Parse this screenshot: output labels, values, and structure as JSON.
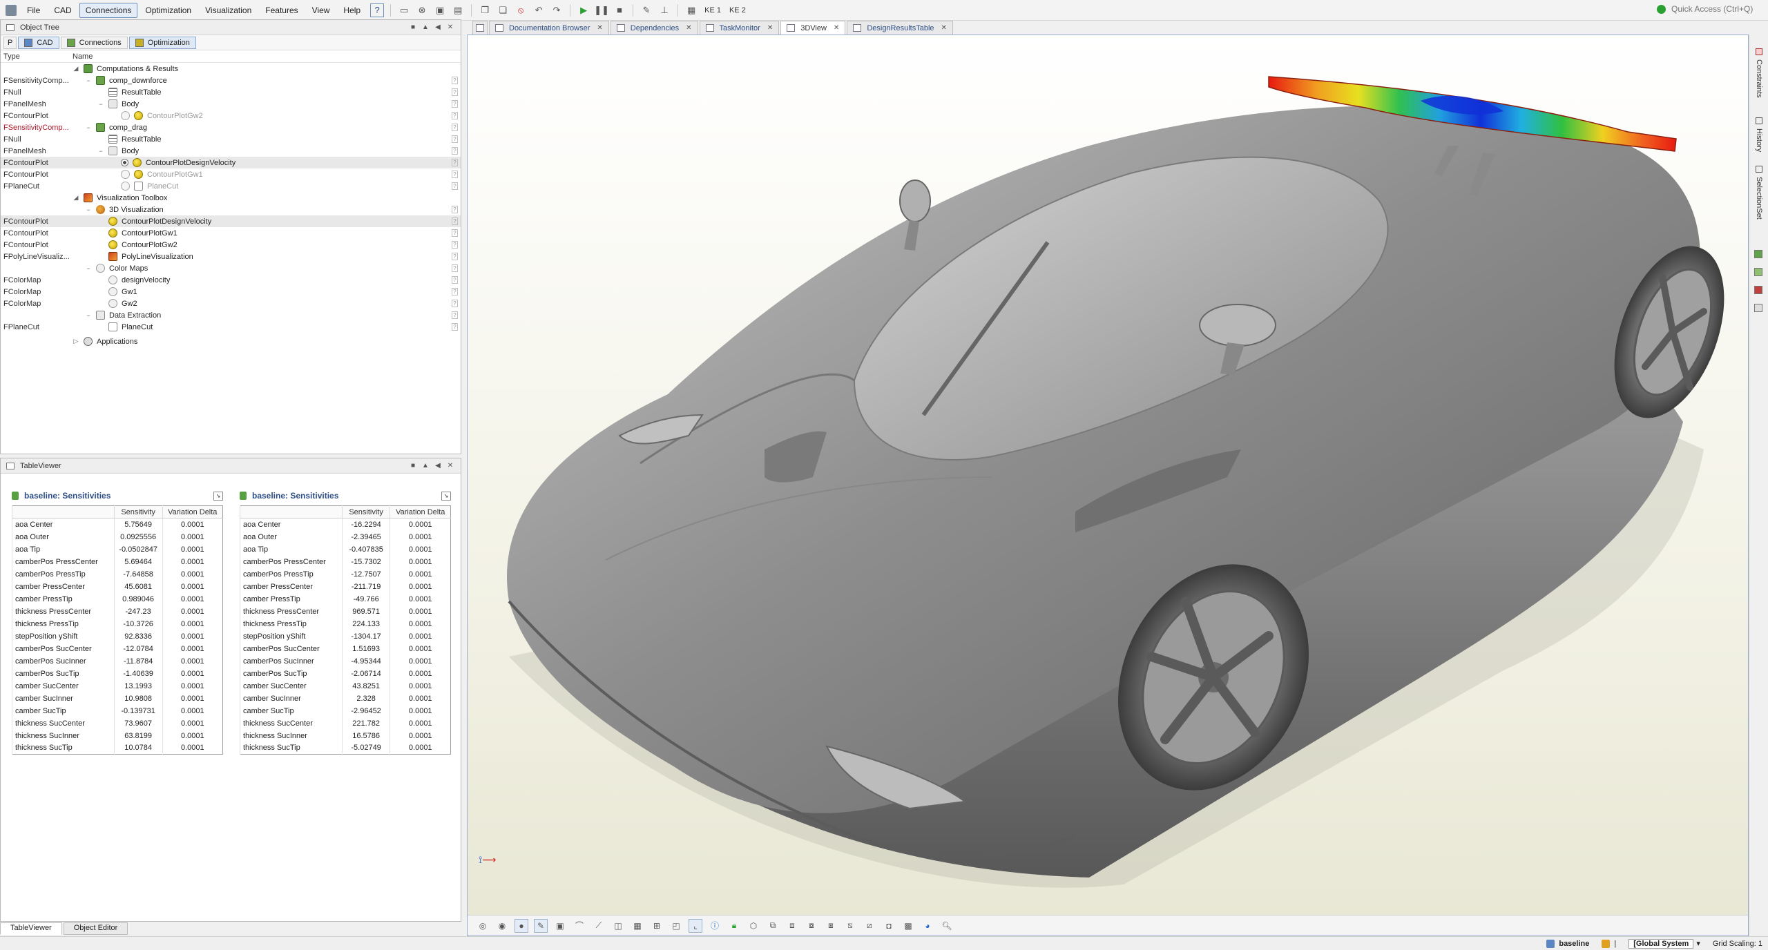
{
  "menu": {
    "items": [
      "File",
      "CAD",
      "Connections",
      "Optimization",
      "Visualization",
      "Features",
      "View",
      "Help"
    ],
    "active": "Connections",
    "toolbar_text": [
      "KE 1",
      "KE 2"
    ],
    "quick_access_placeholder": "Quick Access (Ctrl+Q)"
  },
  "object_tree": {
    "title": "Object Tree",
    "tabs": [
      {
        "prefix": "P",
        "label": "CAD"
      },
      {
        "label": "Connections"
      },
      {
        "label": "Optimization"
      }
    ],
    "columns": {
      "type": "Type",
      "name": "Name"
    },
    "rows": [
      {
        "type": "",
        "name": "Computations & Results",
        "indent": 0,
        "exp": "◢",
        "icon": "comp"
      },
      {
        "type": "FSensitivityComp...",
        "name": "comp_downforce",
        "indent": 1,
        "exp": "−",
        "icon": "green"
      },
      {
        "type": "FNull",
        "name": "ResultTable",
        "indent": 2,
        "exp": "",
        "icon": "table"
      },
      {
        "type": "FPanelMesh",
        "name": "Body",
        "indent": 2,
        "exp": "−",
        "icon": "folder"
      },
      {
        "type": "FContourPlot",
        "name": "ContourPlotGw2",
        "indent": 3,
        "exp": "",
        "icon": "contour",
        "disabled": true,
        "ring": true
      },
      {
        "type": "FSensitivityComp...",
        "name": "comp_drag",
        "indent": 1,
        "exp": "−",
        "icon": "green",
        "red": true
      },
      {
        "type": "FNull",
        "name": "ResultTable",
        "indent": 2,
        "exp": "",
        "icon": "table"
      },
      {
        "type": "FPanelMesh",
        "name": "Body",
        "indent": 2,
        "exp": "−",
        "icon": "folder"
      },
      {
        "type": "FContourPlot",
        "name": "ContourPlotDesignVelocity",
        "indent": 3,
        "exp": "",
        "icon": "contour",
        "radio": true,
        "highlight": true
      },
      {
        "type": "FContourPlot",
        "name": "ContourPlotGw1",
        "indent": 3,
        "exp": "",
        "icon": "contour",
        "disabled": true,
        "ring": true
      },
      {
        "type": "FPlaneCut",
        "name": "PlaneCut",
        "indent": 3,
        "exp": "",
        "icon": "plane",
        "disabled": true,
        "ring": true
      },
      {
        "type": "",
        "name": "Visualization Toolbox",
        "indent": 0,
        "exp": "◢",
        "icon": "viz"
      },
      {
        "type": "",
        "name": "3D Visualization",
        "indent": 1,
        "exp": "−",
        "icon": "vis3d"
      },
      {
        "type": "FContourPlot",
        "name": "ContourPlotDesignVelocity",
        "indent": 2,
        "exp": "",
        "icon": "contour",
        "highlight": true
      },
      {
        "type": "FContourPlot",
        "name": "ContourPlotGw1",
        "indent": 2,
        "exp": "",
        "icon": "contour"
      },
      {
        "type": "FContourPlot",
        "name": "ContourPlotGw2",
        "indent": 2,
        "exp": "",
        "icon": "contour"
      },
      {
        "type": "FPolyLineVisualiz...",
        "name": "PolyLineVisualization",
        "indent": 2,
        "exp": "",
        "icon": "viz"
      },
      {
        "type": "",
        "name": "Color Maps",
        "indent": 1,
        "exp": "−",
        "icon": "cmap"
      },
      {
        "type": "FColorMap",
        "name": "designVelocity",
        "indent": 2,
        "exp": "",
        "icon": "cmap"
      },
      {
        "type": "FColorMap",
        "name": "Gw1",
        "indent": 2,
        "exp": "",
        "icon": "cmap"
      },
      {
        "type": "FColorMap",
        "name": "Gw2",
        "indent": 2,
        "exp": "",
        "icon": "cmap"
      },
      {
        "type": "",
        "name": "Data Extraction",
        "indent": 1,
        "exp": "−",
        "icon": "dataex"
      },
      {
        "type": "FPlaneCut",
        "name": "PlaneCut",
        "indent": 2,
        "exp": "",
        "icon": "plane"
      },
      {
        "type": "",
        "name": "Applications",
        "indent": 0,
        "exp": "▷",
        "icon": "apps",
        "gap": true
      }
    ]
  },
  "table_viewer": {
    "title": "TableViewer",
    "columns": [
      "",
      "Sensitivity",
      "Variation Delta"
    ],
    "tables": [
      {
        "title": "baseline: Sensitivities",
        "rows": [
          [
            "aoa  Center",
            "5.75649",
            "0.0001"
          ],
          [
            "aoa  Outer",
            "0.0925556",
            "0.0001"
          ],
          [
            "aoa  Tip",
            "-0.0502847",
            "0.0001"
          ],
          [
            "camberPos  PressCenter",
            "5.69464",
            "0.0001"
          ],
          [
            "camberPos  PressTip",
            "-7.64858",
            "0.0001"
          ],
          [
            "camber  PressCenter",
            "45.6081",
            "0.0001"
          ],
          [
            "camber  PressTip",
            "0.989046",
            "0.0001"
          ],
          [
            "thickness  PressCenter",
            "-247.23",
            "0.0001"
          ],
          [
            "thickness  PressTip",
            "-10.3726",
            "0.0001"
          ],
          [
            "stepPosition  yShift",
            "92.8336",
            "0.0001"
          ],
          [
            "camberPos  SucCenter",
            "-12.0784",
            "0.0001"
          ],
          [
            "camberPos  SucInner",
            "-11.8784",
            "0.0001"
          ],
          [
            "camberPos  SucTip",
            "-1.40639",
            "0.0001"
          ],
          [
            "camber  SucCenter",
            "13.1993",
            "0.0001"
          ],
          [
            "camber  SucInner",
            "10.9808",
            "0.0001"
          ],
          [
            "camber  SucTip",
            "-0.139731",
            "0.0001"
          ],
          [
            "thickness  SucCenter",
            "73.9607",
            "0.0001"
          ],
          [
            "thickness  SucInner",
            "63.8199",
            "0.0001"
          ],
          [
            "thickness  SucTip",
            "10.0784",
            "0.0001"
          ]
        ]
      },
      {
        "title": "baseline: Sensitivities",
        "rows": [
          [
            "aoa  Center",
            "-16.2294",
            "0.0001"
          ],
          [
            "aoa  Outer",
            "-2.39465",
            "0.0001"
          ],
          [
            "aoa  Tip",
            "-0.407835",
            "0.0001"
          ],
          [
            "camberPos  PressCenter",
            "-15.7302",
            "0.0001"
          ],
          [
            "camberPos  PressTip",
            "-12.7507",
            "0.0001"
          ],
          [
            "camber  PressCenter",
            "-211.719",
            "0.0001"
          ],
          [
            "camber  PressTip",
            "-49.766",
            "0.0001"
          ],
          [
            "thickness  PressCenter",
            "969.571",
            "0.0001"
          ],
          [
            "thickness  PressTip",
            "224.133",
            "0.0001"
          ],
          [
            "stepPosition  yShift",
            "-1304.17",
            "0.0001"
          ],
          [
            "camberPos  SucCenter",
            "1.51693",
            "0.0001"
          ],
          [
            "camberPos  SucInner",
            "-4.95344",
            "0.0001"
          ],
          [
            "camberPos  SucTip",
            "-2.06714",
            "0.0001"
          ],
          [
            "camber  SucCenter",
            "43.8251",
            "0.0001"
          ],
          [
            "camber  SucInner",
            "2.328",
            "0.0001"
          ],
          [
            "camber  SucTip",
            "-2.96452",
            "0.0001"
          ],
          [
            "thickness  SucCenter",
            "221.782",
            "0.0001"
          ],
          [
            "thickness  SucInner",
            "16.5786",
            "0.0001"
          ],
          [
            "thickness  SucTip",
            "-5.02749",
            "0.0001"
          ]
        ]
      }
    ]
  },
  "bottom_tabs": [
    "TableViewer",
    "Object Editor"
  ],
  "doc_tabs": [
    {
      "label": "Documentation Browser",
      "selected": false
    },
    {
      "label": "Dependencies",
      "selected": false
    },
    {
      "label": "TaskMonitor",
      "selected": false
    },
    {
      "label": "3DView",
      "selected": true
    },
    {
      "label": "DesignResultsTable",
      "selected": false
    }
  ],
  "right_panels": [
    "Constraints",
    "History",
    "SelectionSet"
  ],
  "status": {
    "design": "baseline",
    "coordinate_system": "[Global System",
    "grid_scaling": "Grid Scaling: 1"
  },
  "colors": {
    "accent": "#2d4e86",
    "sensitivity_red": "#e02010",
    "sensitivity_blue": "#1030e0",
    "car_body": "#9a9a9a"
  }
}
